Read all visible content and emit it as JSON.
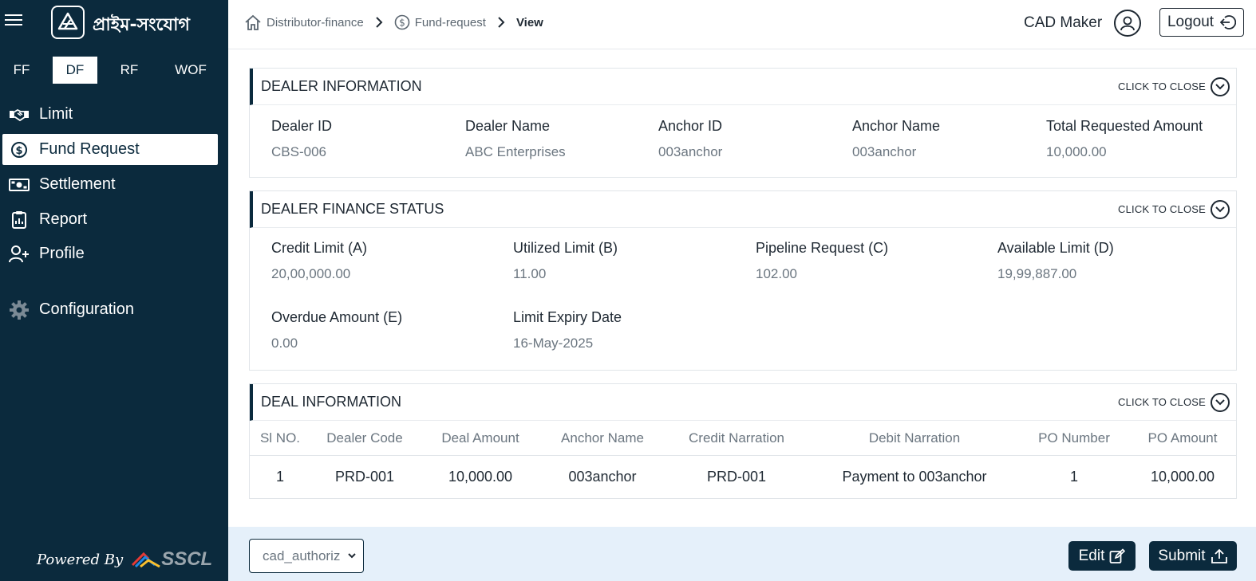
{
  "app": {
    "logo_text": "প্রাইম-সংযোগ"
  },
  "module_tabs": [
    {
      "label": "FF"
    },
    {
      "label": "DF"
    },
    {
      "label": "RF"
    },
    {
      "label": "WOF"
    }
  ],
  "sidebar": {
    "items": [
      {
        "label": "Limit",
        "icon": "handshake-icon"
      },
      {
        "label": "Fund Request",
        "icon": "dollar-circle-icon"
      },
      {
        "label": "Settlement",
        "icon": "cash-icon"
      },
      {
        "label": "Report",
        "icon": "clipboard-icon"
      },
      {
        "label": "Profile",
        "icon": "user-plus-icon"
      },
      {
        "label": "Configuration",
        "icon": "gear-icon"
      }
    ],
    "powered_by": "Powered By",
    "powered_brand": "SSCL"
  },
  "breadcrumb": {
    "items": [
      {
        "label": "Distributor-finance",
        "icon": "home-icon"
      },
      {
        "label": "Fund-request",
        "icon": "dollar-circle-icon"
      },
      {
        "label": "View"
      }
    ]
  },
  "header": {
    "user_name": "CAD Maker",
    "logout_label": "Logout"
  },
  "dealer_info": {
    "title": "DEALER INFORMATION",
    "collapse_label": "CLICK TO CLOSE",
    "fields": [
      {
        "label": "Dealer ID",
        "value": "CBS-006"
      },
      {
        "label": "Dealer Name",
        "value": "ABC Enterprises"
      },
      {
        "label": "Anchor ID",
        "value": "003anchor"
      },
      {
        "label": "Anchor Name",
        "value": "003anchor"
      },
      {
        "label": "Total Requested Amount",
        "value": "10,000.00"
      }
    ]
  },
  "finance_status": {
    "title": "DEALER FINANCE STATUS",
    "collapse_label": "CLICK TO CLOSE",
    "fields": [
      {
        "label": "Credit Limit (A)",
        "value": "20,00,000.00"
      },
      {
        "label": "Utilized Limit (B)",
        "value": "11.00"
      },
      {
        "label": "Pipeline Request (C)",
        "value": "102.00"
      },
      {
        "label": "Available Limit (D)",
        "value": "19,99,887.00"
      },
      {
        "label": "Overdue Amount (E)",
        "value": "0.00"
      },
      {
        "label": "Limit Expiry Date",
        "value": "16-May-2025"
      }
    ]
  },
  "deal_info": {
    "title": "DEAL INFORMATION",
    "collapse_label": "CLICK TO CLOSE",
    "columns": [
      "Sl NO.",
      "Dealer Code",
      "Deal Amount",
      "Anchor Name",
      "Credit Narration",
      "Debit Narration",
      "PO Number",
      "PO Amount"
    ],
    "rows": [
      [
        "1",
        "PRD-001",
        "10,000.00",
        "003anchor",
        "PRD-001",
        "Payment to 003anchor",
        "1",
        "10,000.00"
      ]
    ]
  },
  "footer": {
    "role_select_value": "cad_authoriz",
    "edit_label": "Edit",
    "submit_label": "Submit"
  }
}
